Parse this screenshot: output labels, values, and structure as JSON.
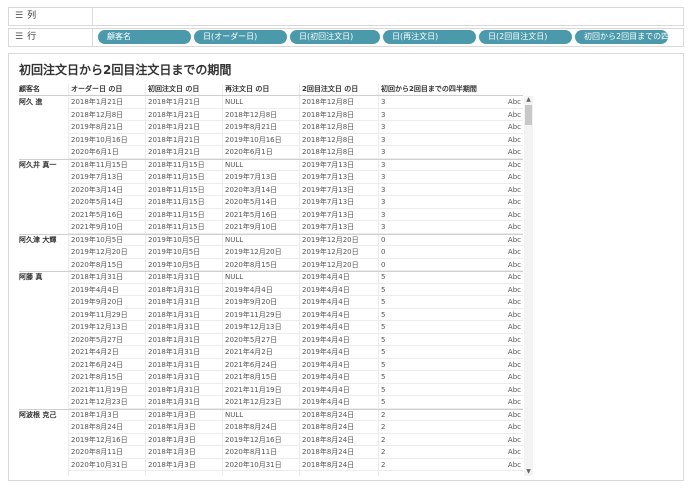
{
  "shelves": {
    "columns": {
      "label": "列"
    },
    "rows": {
      "label": "行",
      "pills": [
        "顧客名",
        "日(オーダー日)",
        "日(初回注文日)",
        "日(再注文日)",
        "日(2回目注文日)",
        "初回から2回目までの四..."
      ]
    }
  },
  "sheet": {
    "title": "初回注文日から2回目注文日までの期間",
    "headers": [
      "顧客名",
      "オーダー日 の日",
      "初回注文日 の日",
      "再注文日 の日",
      "2回目注文日 の日",
      "初回から2回目までの四半期間"
    ],
    "groups": [
      {
        "customer": "阿久 進",
        "rows": [
          [
            "2018年1月21日",
            "2018年1月21日",
            "NULL",
            "2018年12月8日",
            "3",
            "Abc"
          ],
          [
            "2018年12月8日",
            "2018年1月21日",
            "2018年12月8日",
            "2018年12月8日",
            "3",
            "Abc"
          ],
          [
            "2019年8月21日",
            "2018年1月21日",
            "2019年8月21日",
            "2018年12月8日",
            "3",
            "Abc"
          ],
          [
            "2019年10月16日",
            "2018年1月21日",
            "2019年10月16日",
            "2018年12月8日",
            "3",
            "Abc"
          ],
          [
            "2020年6月1日",
            "2018年1月21日",
            "2020年6月1日",
            "2018年12月8日",
            "3",
            "Abc"
          ]
        ]
      },
      {
        "customer": "阿久井 真一",
        "rows": [
          [
            "2018年11月15日",
            "2018年11月15日",
            "NULL",
            "2019年7月13日",
            "3",
            "Abc"
          ],
          [
            "2019年7月13日",
            "2018年11月15日",
            "2019年7月13日",
            "2019年7月13日",
            "3",
            "Abc"
          ],
          [
            "2020年3月14日",
            "2018年11月15日",
            "2020年3月14日",
            "2019年7月13日",
            "3",
            "Abc"
          ],
          [
            "2020年5月14日",
            "2018年11月15日",
            "2020年5月14日",
            "2019年7月13日",
            "3",
            "Abc"
          ],
          [
            "2021年5月16日",
            "2018年11月15日",
            "2021年5月16日",
            "2019年7月13日",
            "3",
            "Abc"
          ],
          [
            "2021年9月10日",
            "2018年11月15日",
            "2021年9月10日",
            "2019年7月13日",
            "3",
            "Abc"
          ]
        ]
      },
      {
        "customer": "阿久津 大輝",
        "rows": [
          [
            "2019年10月5日",
            "2019年10月5日",
            "NULL",
            "2019年12月20日",
            "0",
            "Abc"
          ],
          [
            "2019年12月20日",
            "2019年10月5日",
            "2019年12月20日",
            "2019年12月20日",
            "0",
            "Abc"
          ],
          [
            "2020年8月15日",
            "2019年10月5日",
            "2020年8月15日",
            "2019年12月20日",
            "0",
            "Abc"
          ]
        ]
      },
      {
        "customer": "阿藤 真",
        "rows": [
          [
            "2018年1月31日",
            "2018年1月31日",
            "NULL",
            "2019年4月4日",
            "5",
            "Abc"
          ],
          [
            "2019年4月4日",
            "2018年1月31日",
            "2019年4月4日",
            "2019年4月4日",
            "5",
            "Abc"
          ],
          [
            "2019年9月20日",
            "2018年1月31日",
            "2019年9月20日",
            "2019年4月4日",
            "5",
            "Abc"
          ],
          [
            "2019年11月29日",
            "2018年1月31日",
            "2019年11月29日",
            "2019年4月4日",
            "5",
            "Abc"
          ],
          [
            "2019年12月13日",
            "2018年1月31日",
            "2019年12月13日",
            "2019年4月4日",
            "5",
            "Abc"
          ],
          [
            "2020年5月27日",
            "2018年1月31日",
            "2020年5月27日",
            "2019年4月4日",
            "5",
            "Abc"
          ],
          [
            "2021年4月2日",
            "2018年1月31日",
            "2021年4月2日",
            "2019年4月4日",
            "5",
            "Abc"
          ],
          [
            "2021年6月24日",
            "2018年1月31日",
            "2021年6月24日",
            "2019年4月4日",
            "5",
            "Abc"
          ],
          [
            "2021年8月15日",
            "2018年1月31日",
            "2021年8月15日",
            "2019年4月4日",
            "5",
            "Abc"
          ],
          [
            "2021年11月19日",
            "2018年1月31日",
            "2021年11月19日",
            "2019年4月4日",
            "5",
            "Abc"
          ],
          [
            "2021年12月23日",
            "2018年1月31日",
            "2021年12月23日",
            "2019年4月4日",
            "5",
            "Abc"
          ]
        ]
      },
      {
        "customer": "阿波根 克己",
        "rows": [
          [
            "2018年1月3日",
            "2018年1月3日",
            "NULL",
            "2018年8月24日",
            "2",
            "Abc"
          ],
          [
            "2018年8月24日",
            "2018年1月3日",
            "2018年8月24日",
            "2018年8月24日",
            "2",
            "Abc"
          ],
          [
            "2019年12月16日",
            "2018年1月3日",
            "2019年12月16日",
            "2018年8月24日",
            "2",
            "Abc"
          ],
          [
            "2020年8月11日",
            "2018年1月3日",
            "2020年8月11日",
            "2018年8月24日",
            "2",
            "Abc"
          ],
          [
            "2020年10月31日",
            "2018年1月3日",
            "2020年10月31日",
            "2018年8月24日",
            "2",
            "Abc"
          ]
        ]
      }
    ]
  },
  "icons": {
    "columns_shelf": "columns-icon",
    "rows_shelf": "rows-icon"
  }
}
